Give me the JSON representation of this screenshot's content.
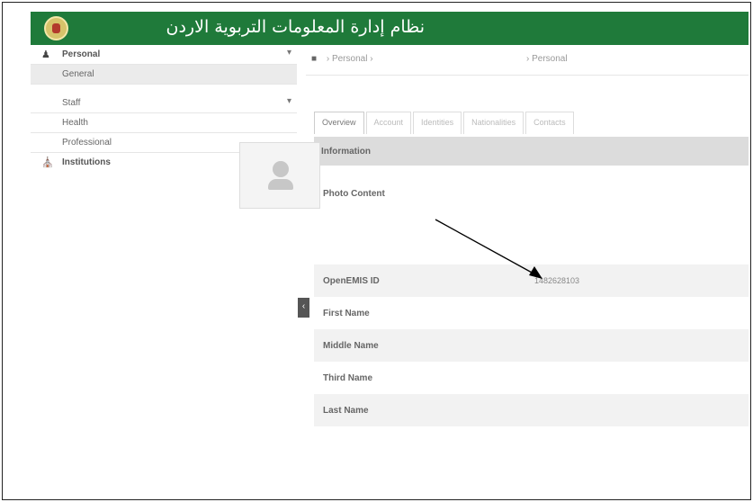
{
  "app": {
    "title": "نظام إدارة المعلومات التربوية الاردن"
  },
  "sidebar": {
    "items": [
      {
        "label": "Personal",
        "icon": "user-icon",
        "expanded": true
      },
      {
        "label": "General",
        "selected": true
      },
      {
        "label": "Staff",
        "has_caret": true
      },
      {
        "label": "Health"
      },
      {
        "label": "Professional"
      },
      {
        "label": "Institutions",
        "icon": "institution-icon"
      }
    ],
    "caret": "▾"
  },
  "breadcrumb": {
    "home_icon": "home-icon",
    "items": [
      "Personal",
      "Personal"
    ],
    "separator": "›"
  },
  "tabs": [
    "Overview",
    "Account",
    "Identities",
    "Nationalities",
    "Contacts"
  ],
  "section": {
    "title": "Information"
  },
  "fields": [
    {
      "label": "Photo Content",
      "value": ""
    },
    {
      "label": "OpenEMIS ID",
      "value": "1482628103"
    },
    {
      "label": "First Name",
      "value": ""
    },
    {
      "label": "Middle Name",
      "value": ""
    },
    {
      "label": "Third Name",
      "value": ""
    },
    {
      "label": "Last Name",
      "value": ""
    }
  ],
  "collapse_button": "‹",
  "colors": {
    "header": "#1f7a3a",
    "info_bar": "#dcdcdc",
    "row_alt": "#f2f2f2"
  }
}
